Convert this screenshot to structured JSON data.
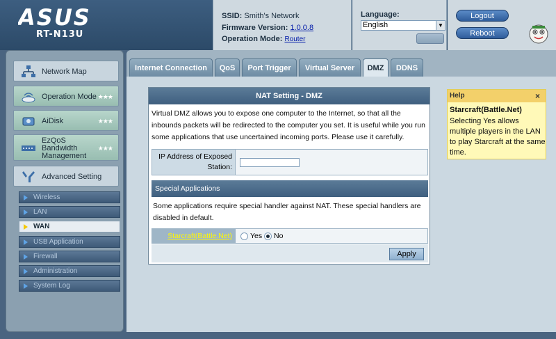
{
  "header": {
    "logo": "ASUS",
    "model": "RT-N13U",
    "ssid_label": "SSID:",
    "ssid_value": "Smith's Network",
    "firmware_label": "Firmware Version:",
    "firmware_value": "1.0.0.8",
    "mode_label": "Operation Mode:",
    "mode_value": "Router",
    "language_label": "Language:",
    "language_value": "English",
    "logout_label": "Logout",
    "reboot_label": "Reboot"
  },
  "sidebar": {
    "menu": [
      {
        "label": "Network Map",
        "icon": "network-map-icon"
      },
      {
        "label": "Operation Mode",
        "icon": "router-icon"
      },
      {
        "label": "AiDisk",
        "icon": "disk-icon"
      },
      {
        "label": "EzQoS Bandwidth Management",
        "icon": "qos-icon",
        "lines": [
          "EzQoS",
          "Bandwidth",
          "Management"
        ]
      },
      {
        "label": "Advanced Setting",
        "icon": "wrench-icon"
      }
    ],
    "stars": "★★★",
    "submenu": [
      {
        "label": "Wireless",
        "active": false
      },
      {
        "label": "LAN",
        "active": false
      },
      {
        "label": "WAN",
        "active": true
      },
      {
        "label": "USB Application",
        "active": false
      },
      {
        "label": "Firewall",
        "active": false
      },
      {
        "label": "Administration",
        "active": false
      },
      {
        "label": "System Log",
        "active": false
      }
    ]
  },
  "tabs": [
    {
      "label": "Internet Connection",
      "active": false
    },
    {
      "label": "QoS",
      "active": false
    },
    {
      "label": "Port Trigger",
      "active": false
    },
    {
      "label": "Virtual Server",
      "active": false
    },
    {
      "label": "DMZ",
      "active": true
    },
    {
      "label": "DDNS",
      "active": false
    }
  ],
  "panel": {
    "title": "NAT Setting - DMZ",
    "description": "Virtual DMZ allows you to expose one computer to the Internet, so that all the inbounds packets will be redirected to the computer you set. It is useful while you run some applications that use uncertained incoming ports. Please use it carefully.",
    "ip_label": "IP Address of Exposed Station:",
    "ip_value": "",
    "special_apps_header": "Special Applications",
    "special_apps_desc": "Some applications require special handler against NAT. These special handlers are disabled in default.",
    "starcraft_label": "Starcraft(Battle.Net)",
    "option_yes": "Yes",
    "option_no": "No",
    "selected_option": "No",
    "apply_label": "Apply"
  },
  "help": {
    "title": "Help",
    "close": "×",
    "heading": "Starcraft(Battle.Net)",
    "body": "Selecting Yes allows multiple players in the LAN to play Starcraft at the same time."
  }
}
